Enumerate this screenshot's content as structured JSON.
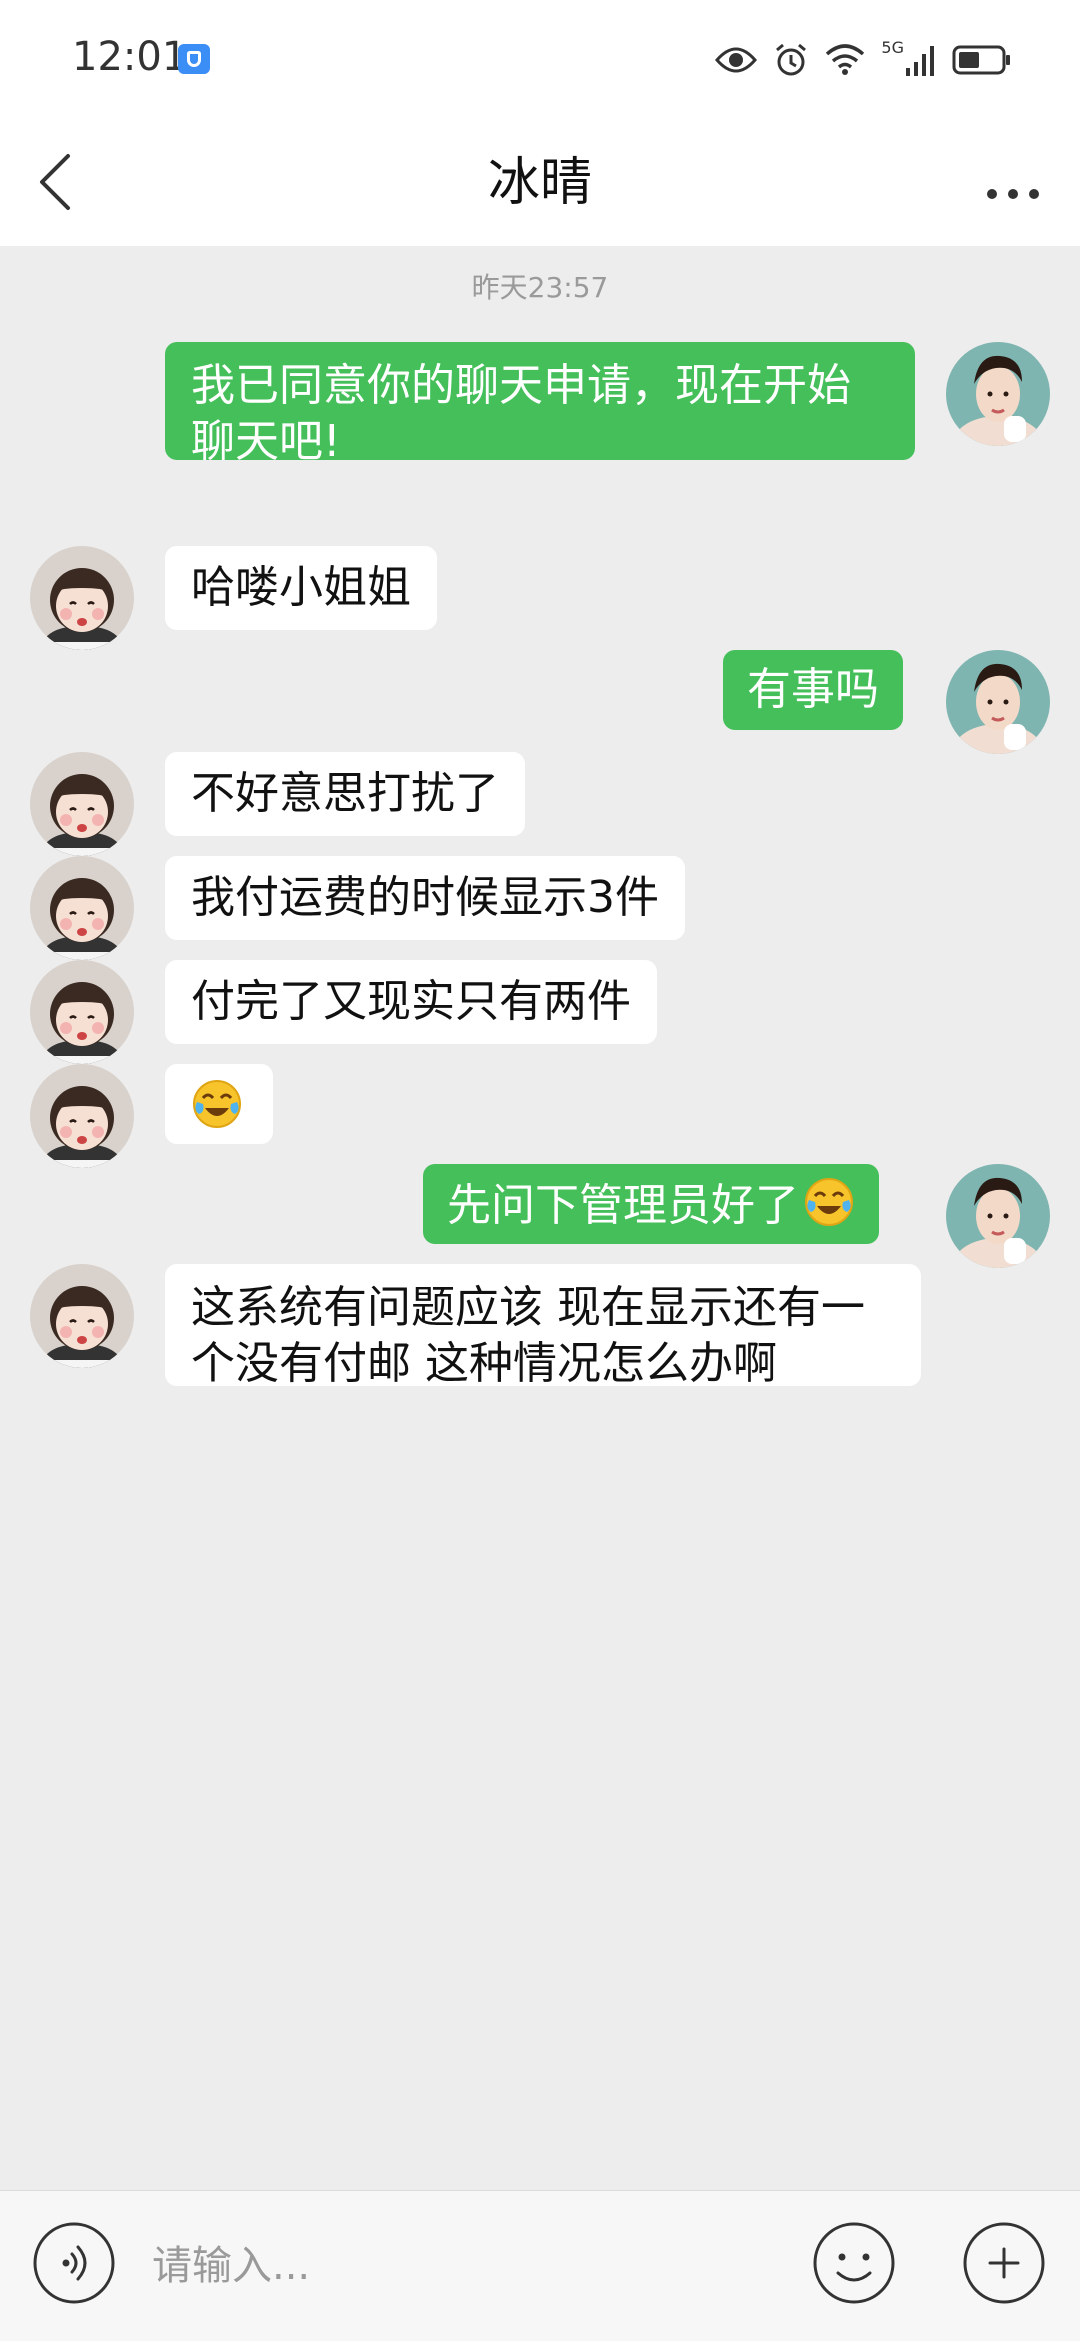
{
  "status_bar": {
    "time": "12:01",
    "network": "5G",
    "icons": [
      "eye-icon",
      "alarm-icon",
      "wifi-icon",
      "signal-icon",
      "battery-icon"
    ]
  },
  "header": {
    "title": "冰晴",
    "back_icon": "chevron-left-icon",
    "more_icon": "more-horizontal-icon"
  },
  "chat": {
    "timestamp": "昨天23:57",
    "messages": [
      {
        "sender": "me",
        "text": "我已同意你的聊天申请，现在开始聊天吧!"
      },
      {
        "sender": "other",
        "text": "哈喽小姐姐"
      },
      {
        "sender": "me",
        "text": "有事吗"
      },
      {
        "sender": "other",
        "text": "不好意思打扰了"
      },
      {
        "sender": "other",
        "text": "我付运费的时候显示3件"
      },
      {
        "sender": "other",
        "text": "付完了又现实只有两件"
      },
      {
        "sender": "other",
        "text": "",
        "emoji": "laugh-cry-emoji"
      },
      {
        "sender": "me",
        "text": "先问下管理员好了",
        "emoji": "laugh-cry-emoji"
      },
      {
        "sender": "other",
        "text": "这系统有问题应该 现在显示还有一个没有付邮 这种情况怎么办啊"
      }
    ]
  },
  "input_bar": {
    "placeholder": "请输入...",
    "voice_icon": "voice-icon",
    "emoji_icon": "smiley-icon",
    "add_icon": "plus-icon"
  },
  "colors": {
    "my_bubble": "#44bf5a",
    "other_bubble": "#ffffff",
    "chat_background": "#ededed"
  }
}
